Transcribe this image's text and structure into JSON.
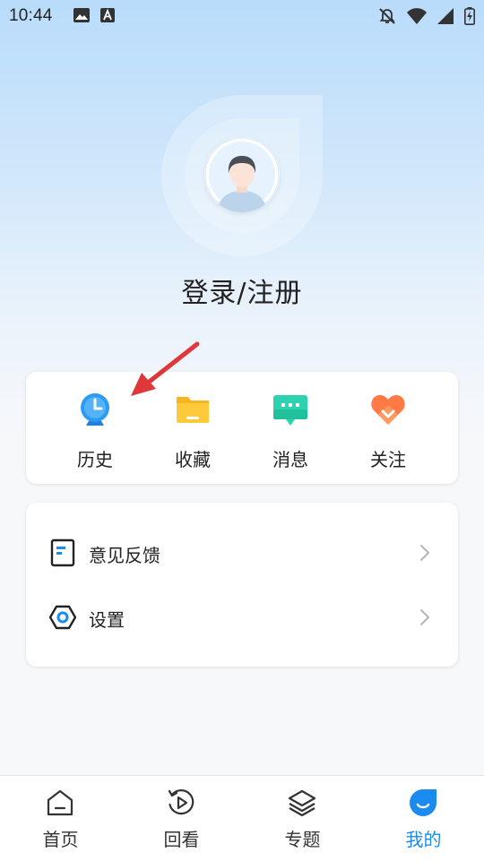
{
  "status_bar": {
    "time": "10:44",
    "left_icons": [
      "image-icon",
      "a-letter-icon"
    ],
    "right_icons": [
      "notifications-off-icon",
      "wifi-icon",
      "cellular-icon",
      "battery-charging-icon"
    ]
  },
  "profile": {
    "avatar": "default-avatar-icon",
    "login_label": "登录/注册"
  },
  "quick_actions": [
    {
      "label": "历史",
      "icon": "history-icon"
    },
    {
      "label": "收藏",
      "icon": "folder-favorites-icon"
    },
    {
      "label": "消息",
      "icon": "message-icon"
    },
    {
      "label": "关注",
      "icon": "heart-follow-icon"
    }
  ],
  "menu": [
    {
      "label": "意见反馈",
      "icon": "feedback-icon"
    },
    {
      "label": "设置",
      "icon": "settings-icon"
    }
  ],
  "tab_bar": {
    "tabs": [
      {
        "label": "首页",
        "icon": "home-icon",
        "active": false
      },
      {
        "label": "回看",
        "icon": "replay-icon",
        "active": false
      },
      {
        "label": "专题",
        "icon": "layers-icon",
        "active": false
      },
      {
        "label": "我的",
        "icon": "profile-drop-icon",
        "active": true
      }
    ]
  },
  "colors": {
    "accent": "#1a8cf0",
    "annotation_arrow": "#e0383a",
    "header_gradient_top": "#b9dcfb"
  }
}
